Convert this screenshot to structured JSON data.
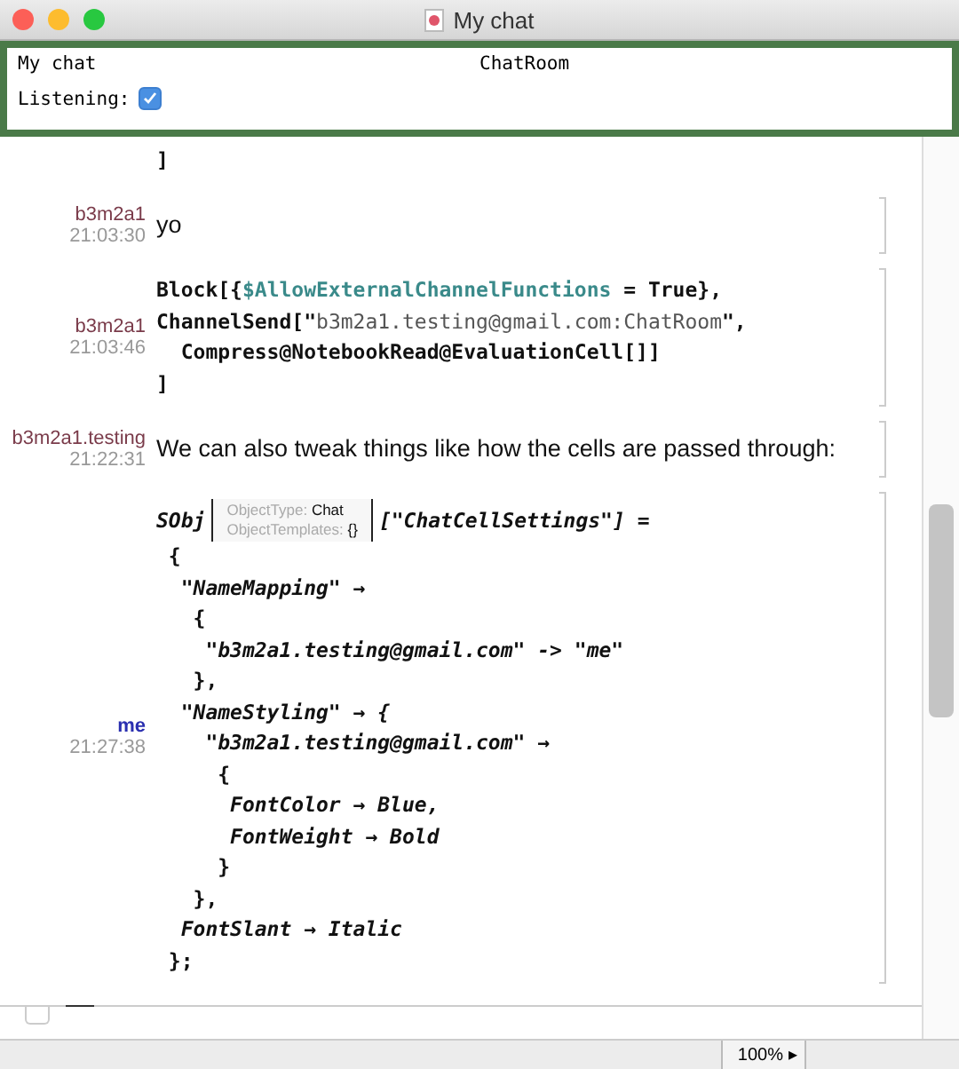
{
  "window": {
    "title": "My chat"
  },
  "header": {
    "chat_name": "My chat",
    "room": "ChatRoom",
    "listening_label": "Listening:",
    "listening": true
  },
  "messages": [
    {
      "kind": "code",
      "lines": [
        [
          {
            "text": "]",
            "kind": "plain"
          }
        ]
      ]
    },
    {
      "kind": "text",
      "sender": "b3m2a1",
      "color": "#7a3b4a",
      "time": "21:03:30",
      "text": "yo"
    },
    {
      "kind": "code",
      "sender": "b3m2a1",
      "color": "#7a3b4a",
      "time": "21:03:46",
      "lines": [
        [
          {
            "text": "Block[{",
            "kind": "plain"
          },
          {
            "text": "$AllowExternalChannelFunctions",
            "kind": "symbol"
          },
          {
            "text": " = True},",
            "kind": "plain"
          }
        ],
        [
          {
            "text": "ChannelSend[\"",
            "kind": "plain"
          },
          {
            "text": "b3m2a1.testing@gmail.com:ChatRoom",
            "kind": "string"
          },
          {
            "text": "\",",
            "kind": "plain"
          }
        ],
        [
          {
            "text": "  Compress@NotebookRead@EvaluationCell[]]",
            "kind": "plain"
          }
        ],
        [
          {
            "text": "]",
            "kind": "plain"
          }
        ]
      ]
    },
    {
      "kind": "text",
      "sender": "b3m2a1.testing",
      "color": "#7a3b4a",
      "time": "21:22:31",
      "text": "We can also tweak things like how the cells are passed through:"
    },
    {
      "kind": "code",
      "sender": "me",
      "color": "#2a2fb0",
      "time": "21:27:38",
      "lines": [
        [
          {
            "text": "SObj",
            "kind": "italic"
          },
          {
            "kind": "object",
            "fields": [
              {
                "label": "ObjectType:",
                "value": "Chat"
              },
              {
                "label": "ObjectTemplates:",
                "value": "{}"
              }
            ]
          },
          {
            "text": "[\"ChatCellSettings\"] =",
            "kind": "italic"
          }
        ],
        [
          {
            "text": " {",
            "kind": "plain"
          }
        ],
        [
          {
            "text": "  \"NameMapping\" →",
            "kind": "italic"
          }
        ],
        [
          {
            "text": "   {",
            "kind": "plain"
          }
        ],
        [
          {
            "text": "    \"b3m2a1.testing@gmail.com\" -> \"me\"",
            "kind": "italic"
          }
        ],
        [
          {
            "text": "   },",
            "kind": "plain"
          }
        ],
        [
          {
            "text": "  \"NameStyling\" → {",
            "kind": "italic"
          }
        ],
        [
          {
            "text": "    \"b3m2a1.testing@gmail.com\" →",
            "kind": "italic"
          }
        ],
        [
          {
            "text": "     {",
            "kind": "plain"
          }
        ],
        [
          {
            "text": "      FontColor → Blue,",
            "kind": "italic"
          }
        ],
        [
          {
            "text": "      FontWeight → Bold",
            "kind": "italic"
          }
        ],
        [
          {
            "text": "     }",
            "kind": "plain"
          }
        ],
        [
          {
            "text": "   },",
            "kind": "plain"
          }
        ],
        [
          {
            "text": "  FontSlant → Italic",
            "kind": "italic"
          }
        ],
        [
          {
            "text": " };",
            "kind": "plain"
          }
        ]
      ]
    }
  ],
  "status_bar": {
    "zoom": "100%",
    "zoom_arrow": "▸"
  }
}
